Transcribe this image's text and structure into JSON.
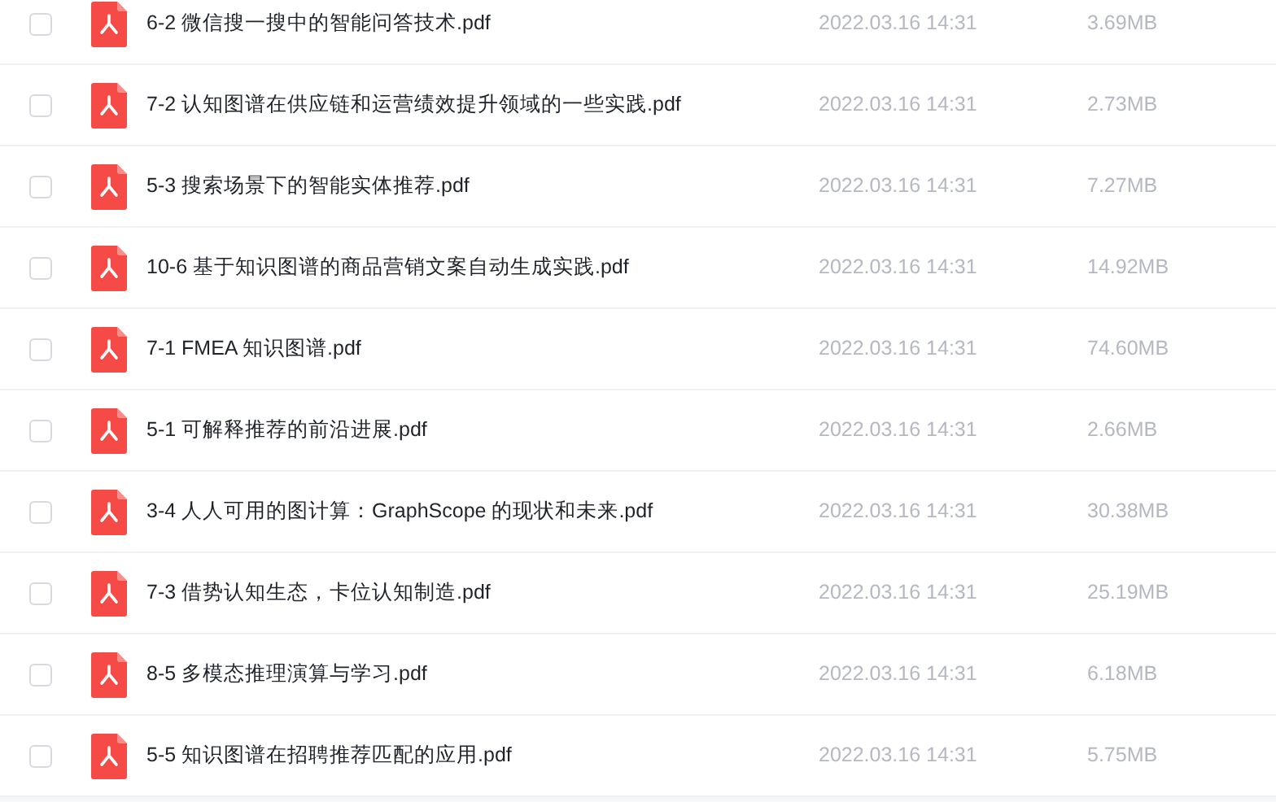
{
  "files": [
    {
      "name": "6-2 微信搜一搜中的智能问答技术.pdf",
      "date": "2022.03.16 14:31",
      "size": "3.69MB",
      "checked": false
    },
    {
      "name": "7-2 认知图谱在供应链和运营绩效提升领域的一些实践.pdf",
      "date": "2022.03.16 14:31",
      "size": "2.73MB",
      "checked": false
    },
    {
      "name": "5-3 搜索场景下的智能实体推荐.pdf",
      "date": "2022.03.16 14:31",
      "size": "7.27MB",
      "checked": false
    },
    {
      "name": "10-6 基于知识图谱的商品营销文案自动生成实践.pdf",
      "date": "2022.03.16 14:31",
      "size": "14.92MB",
      "checked": false
    },
    {
      "name": "7-1 FMEA 知识图谱.pdf",
      "date": "2022.03.16 14:31",
      "size": "74.60MB",
      "checked": false
    },
    {
      "name": "5-1 可解释推荐的前沿进展.pdf",
      "date": "2022.03.16 14:31",
      "size": "2.66MB",
      "checked": false
    },
    {
      "name": "3-4 人人可用的图计算：GraphScope 的现状和未来.pdf",
      "date": "2022.03.16 14:31",
      "size": "30.38MB",
      "checked": false
    },
    {
      "name": "7-3 借势认知生态，卡位认知制造.pdf",
      "date": "2022.03.16 14:31",
      "size": "25.19MB",
      "checked": false
    },
    {
      "name": "8-5 多模态推理演算与学习.pdf",
      "date": "2022.03.16 14:31",
      "size": "6.18MB",
      "checked": false
    },
    {
      "name": "5-5 知识图谱在招聘推荐匹配的应用.pdf",
      "date": "2022.03.16 14:31",
      "size": "5.75MB",
      "checked": false
    }
  ]
}
